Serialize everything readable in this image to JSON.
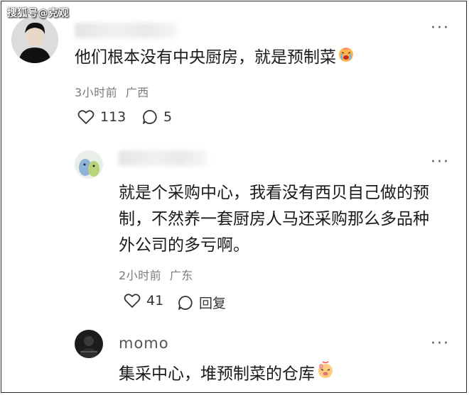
{
  "watermark": "搜狐号@克观",
  "comments": [
    {
      "text": "他们根本没有中央厨房，就是预制菜",
      "emoji": "crying-face-icon",
      "time": "3小时前",
      "location": "广西",
      "likes": "113",
      "replies": "5"
    },
    {
      "text_lines": [
        "就是个采购中心，我看没有西贝自己做的预",
        "制，不然养一套厨房人马还采购那么多品种",
        "外公司的多亏啊。"
      ],
      "time": "2小时前",
      "location": "广东",
      "likes": "41",
      "reply_label": "回复"
    },
    {
      "username": "momo",
      "text": "集采中心，堆预制菜的仓库",
      "emoji": "pouting-face-icon"
    }
  ],
  "more_glyph": "···",
  "colors": {
    "text": "#1a1a1a",
    "meta": "#7a7a7a",
    "border": "#2b2b2b"
  }
}
